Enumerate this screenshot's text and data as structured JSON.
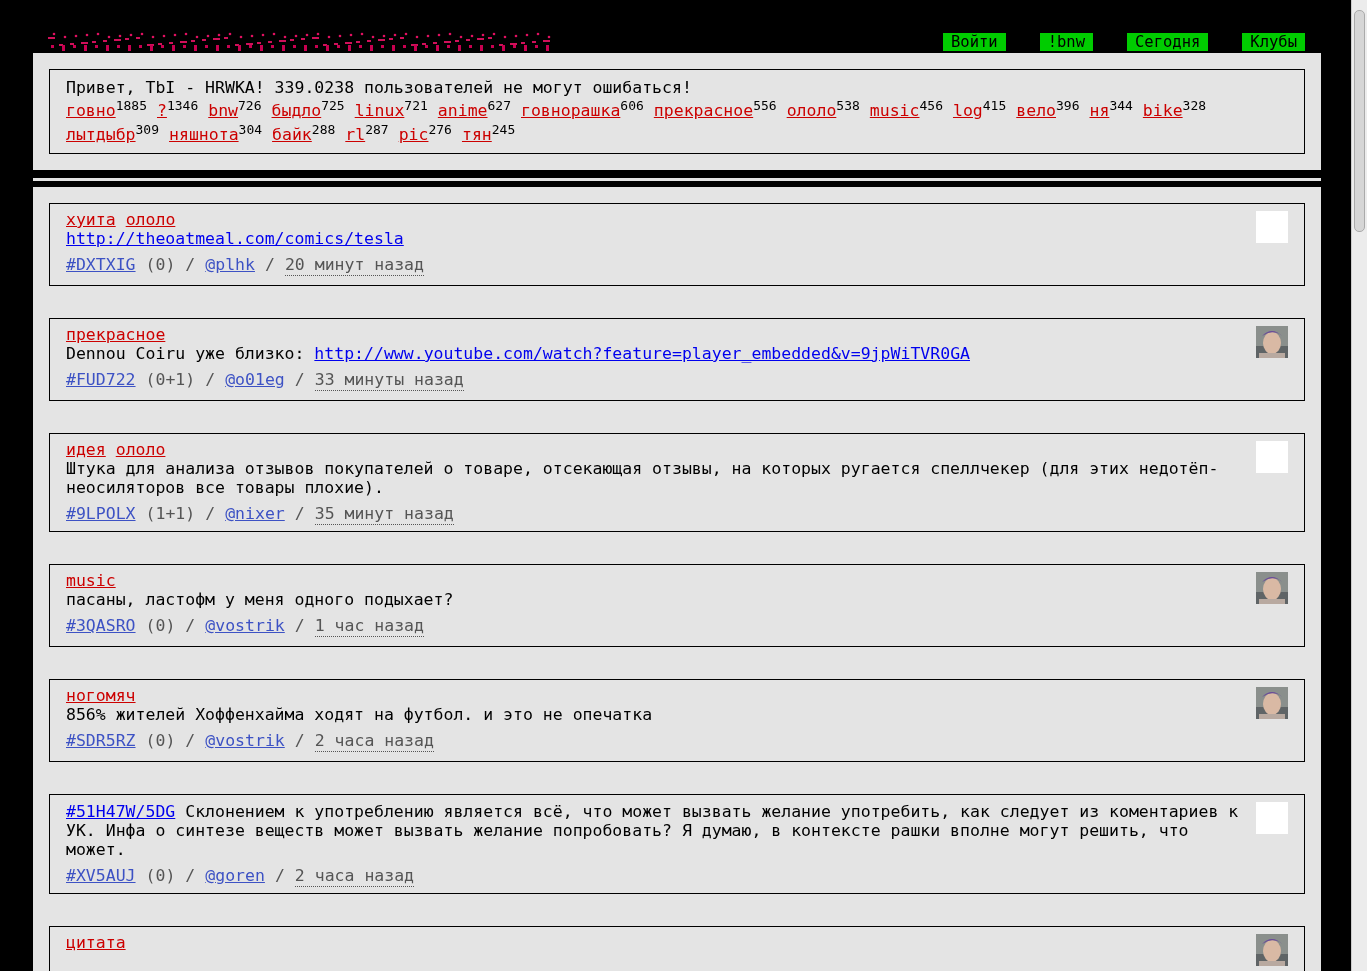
{
  "nav": [
    {
      "label": "Войти"
    },
    {
      "label": "!bnw"
    },
    {
      "label": "Сегодня"
    },
    {
      "label": "Клубы"
    }
  ],
  "greeting": "Привет, TbI - HRWKA! 339.0238 пользователей не могут ошибаться!",
  "tag_cloud": [
    {
      "tag": "говно",
      "count": "1885"
    },
    {
      "tag": "?",
      "count": "1346"
    },
    {
      "tag": "bnw",
      "count": "726"
    },
    {
      "tag": "быдло",
      "count": "725"
    },
    {
      "tag": "linux",
      "count": "721"
    },
    {
      "tag": "anime",
      "count": "627"
    },
    {
      "tag": "говнорашка",
      "count": "606"
    },
    {
      "tag": "прекрасное",
      "count": "556"
    },
    {
      "tag": "ололо",
      "count": "538"
    },
    {
      "tag": "music",
      "count": "456"
    },
    {
      "tag": "log",
      "count": "415"
    },
    {
      "tag": "вело",
      "count": "396"
    },
    {
      "tag": "ня",
      "count": "344"
    },
    {
      "tag": "bike",
      "count": "328"
    },
    {
      "tag": "лытдыбр",
      "count": "309"
    },
    {
      "tag": "няшнота",
      "count": "304"
    },
    {
      "tag": "байк",
      "count": "288"
    },
    {
      "tag": "rl",
      "count": "287"
    },
    {
      "tag": "pic",
      "count": "276"
    },
    {
      "tag": "тян",
      "count": "245"
    }
  ],
  "posts": [
    {
      "tags": [
        "хуита",
        "ололо"
      ],
      "body": [
        {
          "kind": "link",
          "text": "http://theoatmeal.com/comics/tesla"
        }
      ],
      "id": "#DXTXIG",
      "replies": "(0)",
      "separators": [
        "/",
        "/"
      ],
      "user": "@plhk",
      "time": "20 минут назад",
      "avatar_photo": false
    },
    {
      "tags": [
        "прекрасное"
      ],
      "body": [
        {
          "kind": "text",
          "text": "Dennou Coiru уже близко: "
        },
        {
          "kind": "link",
          "text": "http://www.youtube.com/watch?feature=player_embedded&v=9jpWiTVR0GA"
        }
      ],
      "id": "#FUD722",
      "replies": "(0+1)",
      "separators": [
        "/",
        "/"
      ],
      "user": "@o01eg",
      "time": "33 минуты назад",
      "avatar_photo": true
    },
    {
      "tags": [
        "идея",
        "ололо"
      ],
      "body": [
        {
          "kind": "text",
          "text": "Штука для анализа отзывов покупателей о товаре, отсекающая отзывы, на которых ругается спеллчекер (для этих недотёп-неосиляторов все товары плохие)."
        }
      ],
      "id": "#9LPOLX",
      "replies": "(1+1)",
      "separators": [
        "/",
        "/"
      ],
      "user": "@nixer",
      "time": "35 минут назад",
      "avatar_photo": false
    },
    {
      "tags": [
        "music"
      ],
      "body": [
        {
          "kind": "text",
          "text": "пасаны, ластофм у меня одного подыхает?"
        }
      ],
      "id": "#3QASRO",
      "replies": "(0)",
      "separators": [
        "/",
        "/"
      ],
      "user": "@vostrik",
      "time": "1 час назад",
      "avatar_photo": true
    },
    {
      "tags": [
        "ногомяч"
      ],
      "body": [
        {
          "kind": "text",
          "text": "856% жителей Хоффенхайма ходят на футбол. и это не опечатка"
        }
      ],
      "id": "#SDR5RZ",
      "replies": "(0)",
      "separators": [
        "/",
        "/"
      ],
      "user": "@vostrik",
      "time": "2 часа назад",
      "avatar_photo": true
    },
    {
      "body": [
        {
          "kind": "link",
          "text": "#51H47W/5DG"
        },
        {
          "kind": "text",
          "text": " Склонением к употреблению является всё, что может вызвать желание употребить, как следует из коментариев к УК. Инфа о синтезе веществ может вызвать желание попробовать? Я думаю, в контексте рашки вполне могут решить, что может."
        }
      ],
      "id": "#XV5AUJ",
      "replies": "(0)",
      "separators": [
        "/",
        "/"
      ],
      "user": "@goren",
      "time": "2 часа назад",
      "avatar_photo": false
    },
    {
      "tags": [
        "цитата"
      ],
      "avatar_photo": true
    }
  ]
}
